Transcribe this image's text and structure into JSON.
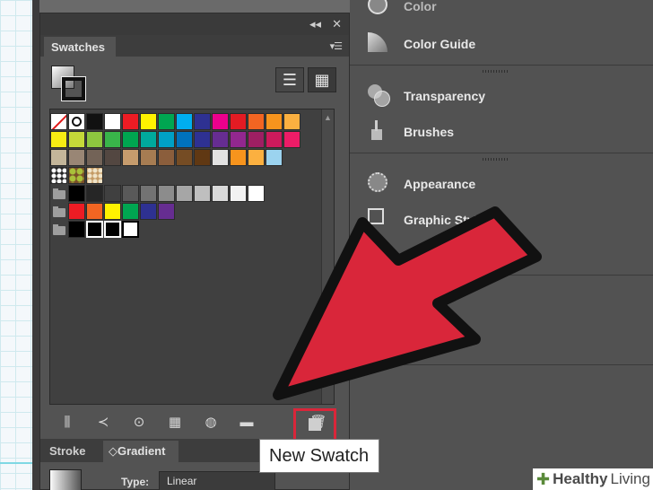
{
  "swatches_panel": {
    "tab": "Swatches",
    "menu_icon": "panel-menu-icon",
    "collapse_icon": "◂◂",
    "close_icon": "✕",
    "views": {
      "list_icon": "☰",
      "grid_icon": "▦"
    }
  },
  "swatch_rows": [
    {
      "type": "swatch",
      "items": [
        "none",
        "registration",
        "#111111",
        "#ffffff",
        "#ed1c24",
        "#fff200",
        "#00a651",
        "#00aeef",
        "#2e3192",
        "#ec008c",
        "#e31b23",
        "#f26522",
        "#f7941d",
        "#fbb040"
      ]
    },
    {
      "type": "swatch",
      "items": [
        "#f7ec13",
        "#c5d939",
        "#8dc63f",
        "#39b54a",
        "#00a650",
        "#00a99d",
        "#00a0c6",
        "#0072bc",
        "#2e3192",
        "#662d91",
        "#92278f",
        "#9e1f63",
        "#ce1a5c",
        "#ed1c67"
      ]
    },
    {
      "type": "swatch",
      "items": [
        "#c4b69a",
        "#998675",
        "#736357",
        "#534741",
        "#c69c6d",
        "#a67c52",
        "#8b5e3c",
        "#754c24",
        "#603813",
        "#e2e2e2",
        "#f7941d",
        "#fbb040",
        "#9bd3ef"
      ]
    },
    {
      "type": "pattern",
      "items": [
        "pat1",
        "pat2",
        "pat3"
      ]
    },
    {
      "type": "folder",
      "items": [
        "#000000",
        "#262626",
        "#404040",
        "#595959",
        "#737373",
        "#8c8c8c",
        "#a6a6a6",
        "#bfbfbf",
        "#d9d9d9",
        "#f2f2f2",
        "#ffffff"
      ]
    },
    {
      "type": "folder",
      "items": [
        "#ed1c24",
        "#f26522",
        "#fff200",
        "#00a651",
        "#2e3192",
        "#662d91"
      ]
    },
    {
      "type": "folder",
      "items": [
        "#000000",
        "#000000-w",
        "#000000-w",
        "#ffffff-b"
      ]
    }
  ],
  "bottom_toolbar": {
    "icons": [
      "library-icon",
      "share-icon",
      "show-kinds-icon",
      "swatch-options-icon",
      "color-group-icon",
      "folder-icon",
      "new-swatch-icon",
      "trash-icon"
    ],
    "glyphs": [
      "⫼",
      "≺",
      "⊙",
      "▦",
      "◍",
      "▬",
      "",
      "🗑"
    ]
  },
  "lower_tabs": {
    "stroke": "Stroke",
    "gradient": "◇Gradient"
  },
  "gradient": {
    "type_label": "Type:",
    "type_value": "Linear"
  },
  "right_panel": {
    "items": [
      {
        "label": "Color"
      },
      {
        "label": "Color Guide"
      },
      {
        "label": "Transparency"
      },
      {
        "label": "Brushes"
      },
      {
        "label": "Appearance"
      },
      {
        "label": "Graphic Styles"
      }
    ]
  },
  "tooltip": "New Swatch",
  "watermark": {
    "brand": "Healthy",
    "rest": "Living"
  },
  "colors": {
    "arrow": "#d9263a",
    "highlight": "#d9263a"
  }
}
